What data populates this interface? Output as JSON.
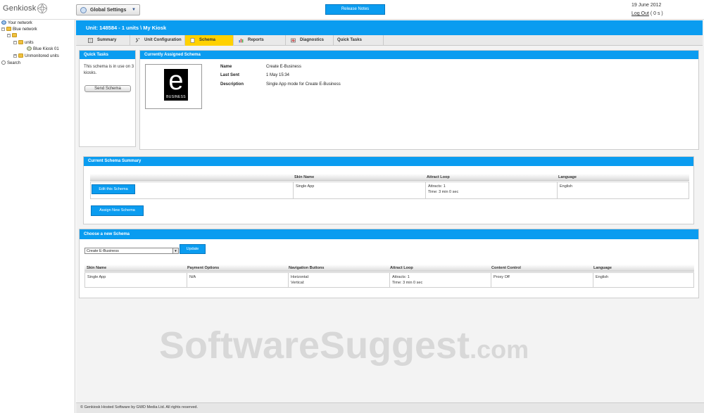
{
  "app": {
    "logo": "Genkiosk"
  },
  "topbar": {
    "settings_label": "Global Settings",
    "release_notes": "Release Notes",
    "date": "19 June 2012",
    "logout": "Log Out",
    "logout_suffix": " ( 0 s )"
  },
  "sidebar": {
    "items": [
      {
        "label": "Your network"
      },
      {
        "label": "Blue network"
      },
      {
        "label": ""
      },
      {
        "label": "units"
      },
      {
        "label": "Blue Kiosk 01"
      },
      {
        "label": "Unmonitored units"
      },
      {
        "label": "Search"
      }
    ]
  },
  "header": {
    "unit_title": "Unit: 148584 - 1 units \\ My Kiosk"
  },
  "tabs": [
    {
      "label": "Summary"
    },
    {
      "label": "Unit Configuration"
    },
    {
      "label": "Schema"
    },
    {
      "label": "Reports"
    },
    {
      "label": "Diagnostics"
    },
    {
      "label": "Quick Tasks"
    }
  ],
  "quick_tasks": {
    "title": "Quick Tasks",
    "text": "This schema is in use on 3 kiosks.",
    "send_button": "Send Schema"
  },
  "assigned": {
    "title": "Currently Assigned Schema",
    "logo_letter": "e",
    "logo_text": "BUSINESS",
    "fields": [
      {
        "label": "Name",
        "value": "Create E-Business"
      },
      {
        "label": "Last Sent",
        "value": "1 May 15:34"
      },
      {
        "label": "Description",
        "value": "Single App mode for Create E-Business"
      }
    ]
  },
  "summary": {
    "title": "Current Schema Summary",
    "columns": [
      "Skin Name",
      "Attract Loop",
      "Language"
    ],
    "edit_button": "Edit this Schema",
    "row": {
      "skin": "Single App",
      "attract1": "Attracts: 1",
      "attract2": "Time: 3 min 0 sec",
      "language": "English"
    },
    "assign_button": "Assign New Schema"
  },
  "choose": {
    "title": "Choose a new Schema",
    "select_value": "Create E-Business",
    "update_button": "Update",
    "columns": [
      "Skin Name",
      "Payment Options",
      "Navigation Buttons",
      "Attract Loop",
      "Content Control",
      "Language"
    ],
    "row": {
      "skin": "Single App",
      "payment": "N/A",
      "nav1": "Horizontal:",
      "nav2": "Vertical:",
      "attract1": "Attracts: 1",
      "attract2": "Time: 3 min 0 sec",
      "content": "Proxy Off",
      "language": "English"
    }
  },
  "footer": {
    "text": "© Genkiosk Hosted Software by GWD Media Ltd. All rights reserved."
  },
  "watermark": {
    "main": "SoftwareSuggest",
    "suffix": ".com"
  },
  "colors": {
    "accent": "#0a9cf0",
    "active_tab": "#ffd100"
  }
}
